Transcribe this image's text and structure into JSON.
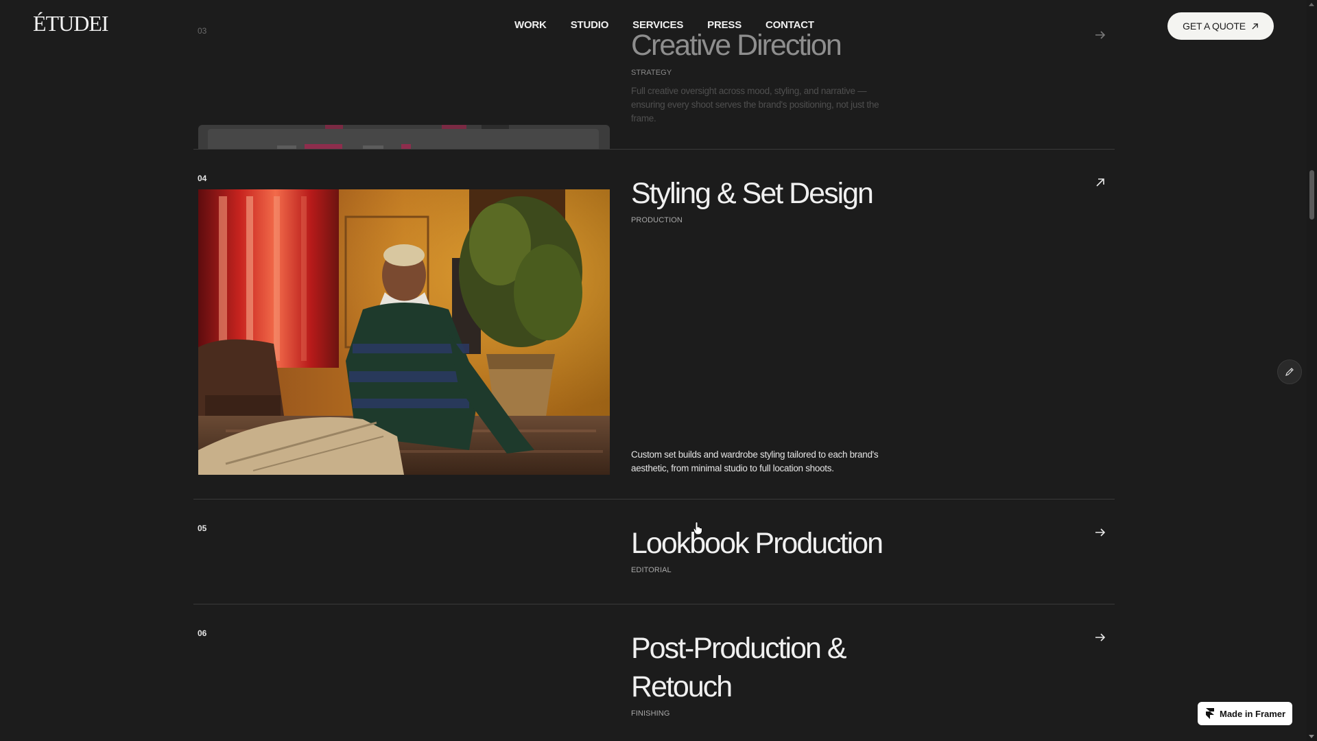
{
  "header": {
    "logo": "ÉTUDEI",
    "nav": [
      "WORK",
      "STUDIO",
      "SERVICES",
      "PRESS",
      "CONTACT"
    ],
    "quote_label": "GET A QUOTE"
  },
  "services": [
    {
      "number": "03",
      "title": "Creative Direction",
      "tag": "STRATEGY",
      "description": "Full creative oversight across mood, styling, and narrative — ensuring every shoot serves the brand's positioning, not just the frame.",
      "state": "collapsing"
    },
    {
      "number": "04",
      "title": "Styling & Set Design",
      "tag": "PRODUCTION",
      "description": "Custom set builds and wardrobe styling tailored to each brand's aesthetic, from minimal studio to full location shoots.",
      "state": "expanded"
    },
    {
      "number": "05",
      "title": "Lookbook Production",
      "tag": "EDITORIAL",
      "state": "collapsed"
    },
    {
      "number": "06",
      "title_line1": "Post-Production &",
      "title_line2": "Retouch",
      "tag": "FINISHING",
      "state": "collapsed"
    }
  ],
  "icons": {
    "arrow": "arrow-right-icon",
    "expand": "arrow-up-right-icon",
    "edit": "pencil-icon",
    "framer": "framer-logo-icon"
  },
  "badge": {
    "label": "Made in Framer"
  },
  "colors": {
    "background": "#1c1c1c",
    "text": "#f0f0f0",
    "muted": "#a9a9a9",
    "divider": "#3a3a3a",
    "button": "#f4f4f1"
  }
}
